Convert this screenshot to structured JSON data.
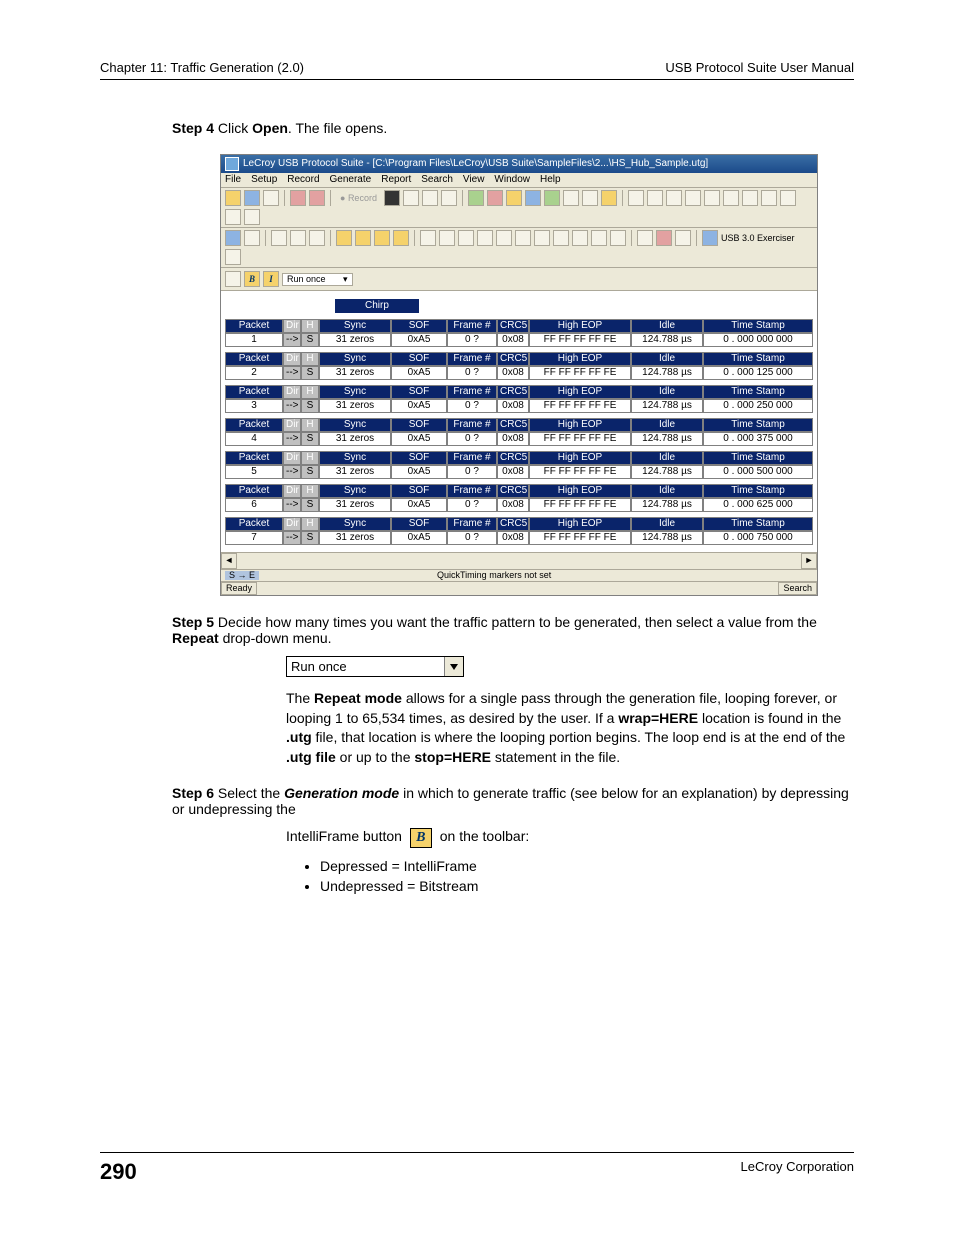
{
  "header": {
    "left": "Chapter 11: Traffic Generation (2.0)",
    "right": "USB Protocol Suite User Manual"
  },
  "footer": {
    "page": "290",
    "company": "LeCroy Corporation"
  },
  "step4": {
    "label": "Step 4",
    "text_prefix": "  Click ",
    "open": "Open",
    "text_suffix": ". The file opens."
  },
  "shot": {
    "title": "LeCroy USB Protocol Suite - [C:\\Program Files\\LeCroy\\USB Suite\\SampleFiles\\2...\\HS_Hub_Sample.utg]",
    "menus": [
      "File",
      "Setup",
      "Record",
      "Generate",
      "Report",
      "Search",
      "View",
      "Window",
      "Help"
    ],
    "record_label": "Record",
    "runonce_label": "Run once",
    "usb30": "USB 3.0 Exerciser",
    "chirp": "Chirp",
    "columns": [
      "Packet",
      "Dir",
      "H/S",
      "Sync",
      "SOF",
      "Frame #",
      "CRC5",
      "High EOP",
      "Idle",
      "Time Stamp"
    ],
    "sync_val": "31 zeros",
    "sof_val": "0xA5",
    "frame_val": "0 ?",
    "crc_val": "0x08",
    "eop_val": "FF FF FF FF FE",
    "idle_val": "124.788 µs",
    "dir_val": "-->",
    "h_val": "H",
    "s_val": "S",
    "packets": [
      {
        "n": "1",
        "ts": "0 . 000 000 000"
      },
      {
        "n": "2",
        "ts": "0 . 000 125 000"
      },
      {
        "n": "3",
        "ts": "0 . 000 250 000"
      },
      {
        "n": "4",
        "ts": "0 . 000 375 000"
      },
      {
        "n": "5",
        "ts": "0 . 000 500 000"
      },
      {
        "n": "6",
        "ts": "0 . 000 625 000"
      },
      {
        "n": "7",
        "ts": "0 . 000 750 000"
      }
    ],
    "midstatus_se": "S → E",
    "midstatus_text": "QuickTiming markers not set",
    "status_ready": "Ready",
    "status_search": "Search"
  },
  "step5": {
    "label": "Step 5",
    "line1_a": "  Decide how many times you want the traffic pattern to be generated, then select a value from the ",
    "repeat": "Repeat",
    "line1_b": " drop-down menu."
  },
  "dropdown": {
    "value": "Run once"
  },
  "repeat_para": {
    "a": "The ",
    "rm": "Repeat mode",
    "b": " allows for a single pass through the generation file, looping forever, or looping 1 to 65,534 times, as desired by the user. If a ",
    "wrap": "wrap=HERE",
    "c": " location is found in the ",
    "utg1": ".utg",
    "d": " file, that location is where the looping portion begins. The loop end is at the end of the ",
    "utg2": ".utg file",
    "e": " or up to the ",
    "stop": "stop=HERE",
    "f": " statement in the file."
  },
  "step6": {
    "label": "Step 6",
    "a": "  Select the ",
    "gen": "Generation mode",
    "b": " in which to generate traffic (see below for an explanation) by depressing or undepressing the",
    "intelli_a": "IntelliFrame button ",
    "intelli_b": " on the toolbar:",
    "btn_char": "B",
    "bul1": "Depressed = IntelliFrame",
    "bul2": "Undepressed = Bitstream"
  }
}
